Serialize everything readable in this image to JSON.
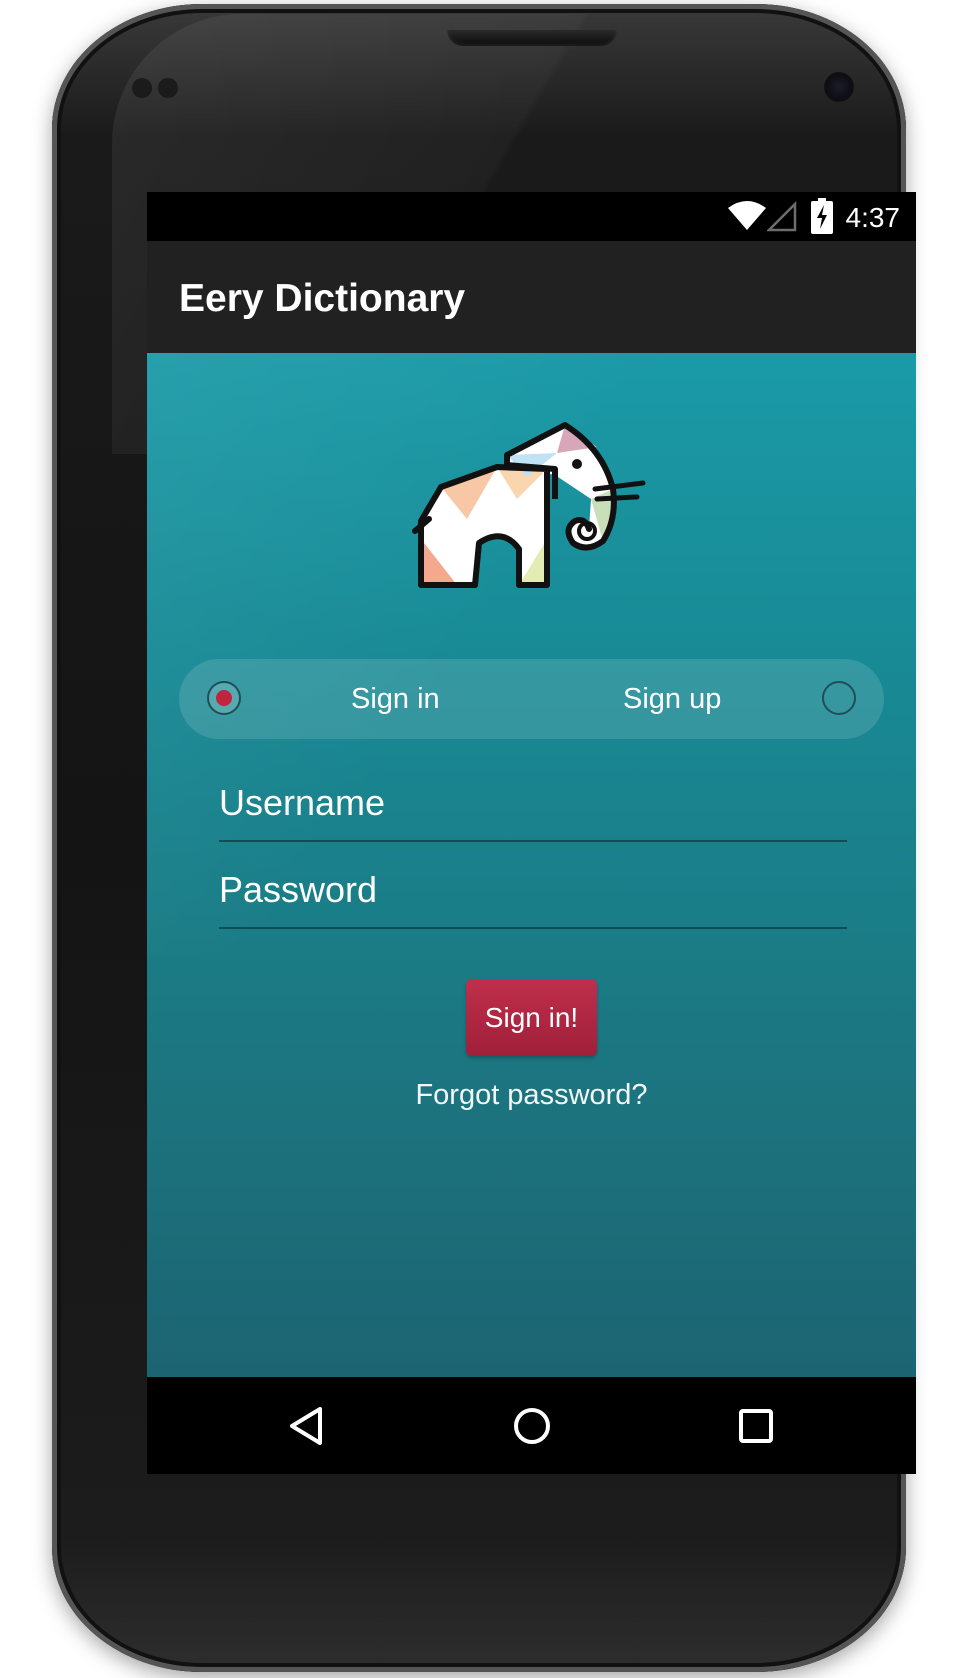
{
  "status_bar": {
    "time": "4:37",
    "icons": [
      "wifi-icon",
      "cell-signal-icon",
      "battery-charging-icon"
    ]
  },
  "app_bar": {
    "title": "Eery Dictionary"
  },
  "logo": {
    "icon": "elephant-logo"
  },
  "mode_toggle": {
    "sign_in_label": "Sign in",
    "sign_up_label": "Sign up",
    "selected": "Sign in"
  },
  "form": {
    "username_placeholder": "Username",
    "password_placeholder": "Password",
    "submit_label": "Sign in!",
    "forgot_label": "Forgot password?"
  },
  "nav_bar": {
    "icons": [
      "back-icon",
      "home-icon",
      "recents-icon"
    ]
  },
  "colors": {
    "accent": "#b02842",
    "background_top": "#1a9aa7",
    "background_bottom": "#1d6472",
    "app_bar": "#212121"
  }
}
